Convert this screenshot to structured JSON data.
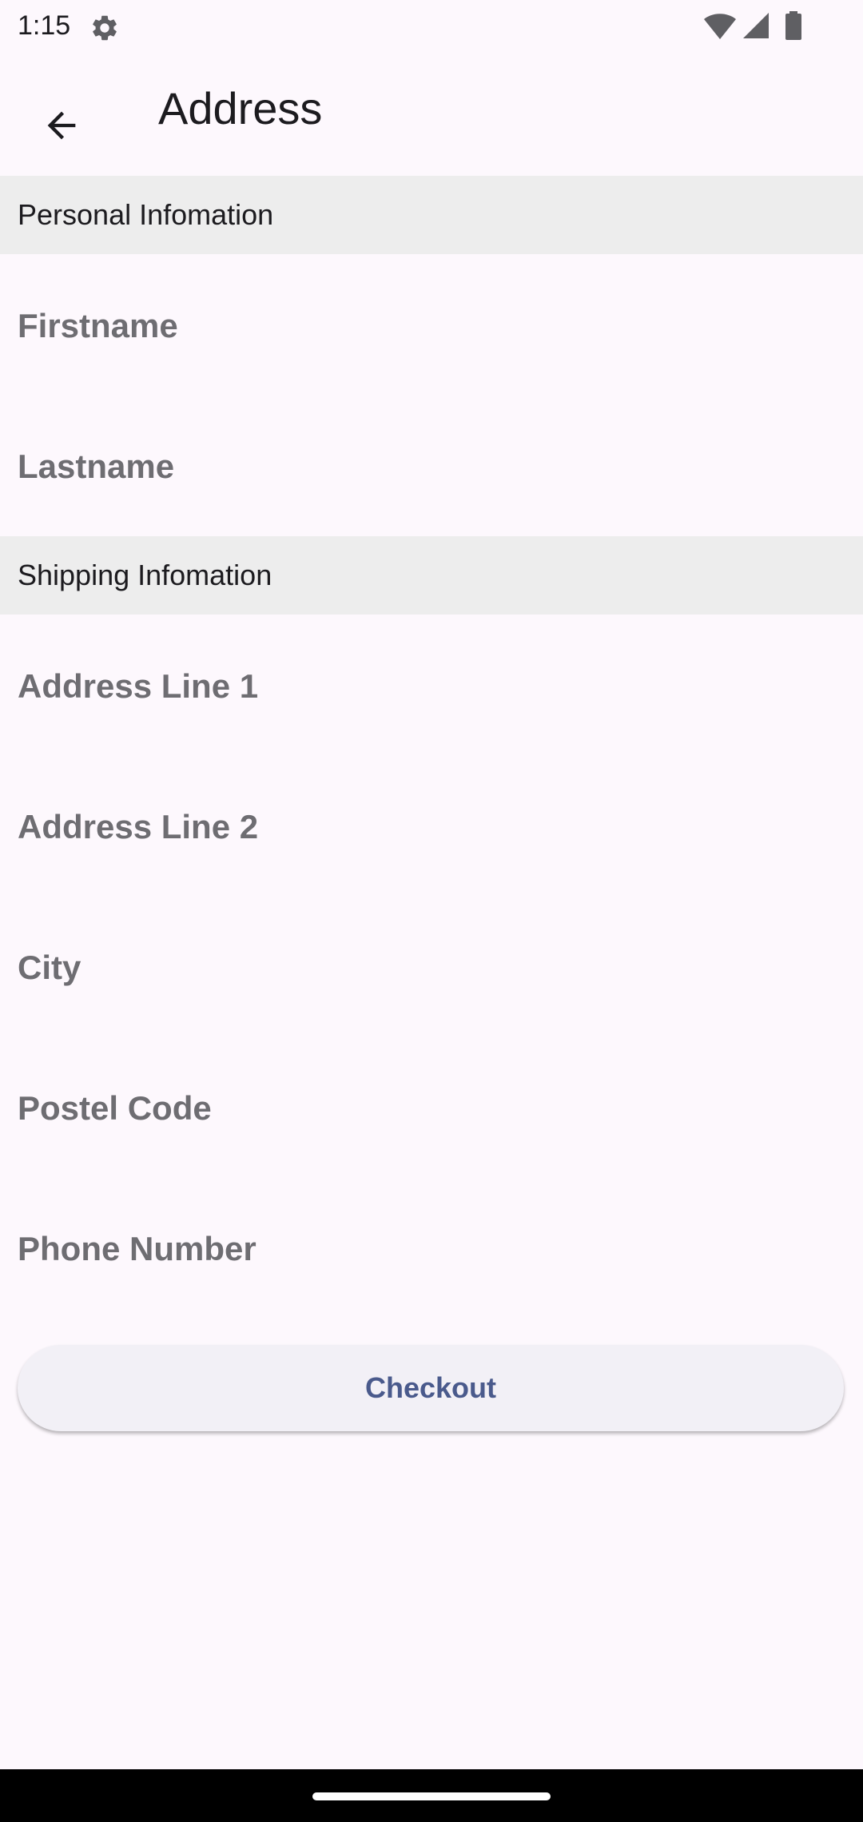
{
  "status_bar": {
    "time": "1:15",
    "icons": [
      "gear-icon",
      "wifi-icon",
      "signal-icon",
      "battery-icon"
    ]
  },
  "app_bar": {
    "back_icon": "arrow-back-icon",
    "title": "Address"
  },
  "sections": {
    "personal": {
      "title": "Personal Infomation"
    },
    "shipping": {
      "title": "Shipping Infomation"
    }
  },
  "fields": {
    "firstname": {
      "placeholder": "Firstname",
      "value": ""
    },
    "lastname": {
      "placeholder": "Lastname",
      "value": ""
    },
    "address1": {
      "placeholder": "Address Line 1",
      "value": ""
    },
    "address2": {
      "placeholder": "Address Line 2",
      "value": ""
    },
    "city": {
      "placeholder": "City",
      "value": ""
    },
    "postal": {
      "placeholder": "Postel Code",
      "value": ""
    },
    "phone": {
      "placeholder": "Phone Number",
      "value": ""
    }
  },
  "checkout": {
    "label": "Checkout"
  },
  "colors": {
    "background": "#FDF8FD",
    "section_header_bg": "#EDEDED",
    "button_bg": "#F2F0F6",
    "button_text": "#4A5A8C",
    "placeholder": "#6E6D72"
  }
}
